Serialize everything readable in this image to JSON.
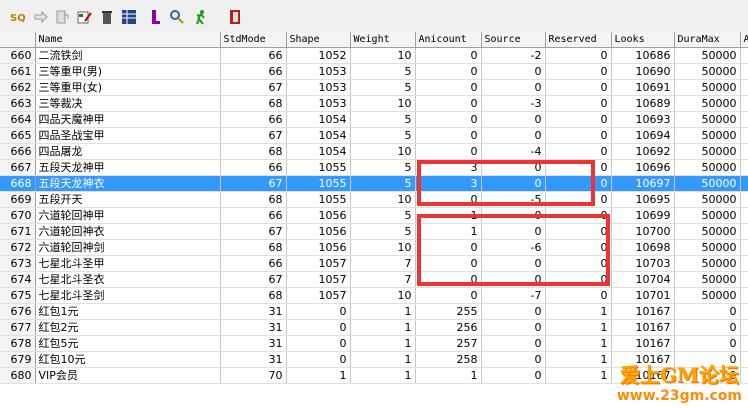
{
  "columns": [
    "",
    "Name",
    "StdMode",
    "Shape",
    "Weight",
    "Anicount",
    "Source",
    "Reserved",
    "Looks",
    "DuraMax",
    "A"
  ],
  "rows": [
    [
      "660",
      "二流铁剑",
      "66",
      "1052",
      "10",
      "0",
      "-2",
      "0",
      "10686",
      "50000"
    ],
    [
      "661",
      "三等重甲(男)",
      "66",
      "1053",
      "5",
      "0",
      "0",
      "0",
      "10690",
      "50000"
    ],
    [
      "662",
      "三等重甲(女)",
      "67",
      "1053",
      "5",
      "0",
      "0",
      "0",
      "10691",
      "50000"
    ],
    [
      "663",
      "三等裁决",
      "68",
      "1053",
      "10",
      "0",
      "-3",
      "0",
      "10689",
      "50000"
    ],
    [
      "664",
      "四品天魔神甲",
      "66",
      "1054",
      "5",
      "0",
      "0",
      "0",
      "10693",
      "50000"
    ],
    [
      "665",
      "四品圣战宝甲",
      "67",
      "1054",
      "5",
      "0",
      "0",
      "0",
      "10694",
      "50000"
    ],
    [
      "666",
      "四品屠龙",
      "68",
      "1054",
      "10",
      "0",
      "-4",
      "0",
      "10692",
      "50000"
    ],
    [
      "667",
      "五段天龙神甲",
      "66",
      "1055",
      "5",
      "3",
      "0",
      "0",
      "10696",
      "50000"
    ],
    [
      "668",
      "五段天龙神衣",
      "67",
      "1055",
      "5",
      "3",
      "0",
      "0",
      "10697",
      "50000"
    ],
    [
      "669",
      "五段开天",
      "68",
      "1055",
      "10",
      "0",
      "-5",
      "0",
      "10695",
      "50000"
    ],
    [
      "670",
      "六道轮回神甲",
      "66",
      "1056",
      "5",
      "1",
      "0",
      "0",
      "10699",
      "50000"
    ],
    [
      "671",
      "六道轮回神衣",
      "67",
      "1056",
      "5",
      "1",
      "0",
      "0",
      "10700",
      "50000"
    ],
    [
      "672",
      "六道轮回神剑",
      "68",
      "1056",
      "10",
      "0",
      "-6",
      "0",
      "10698",
      "50000"
    ],
    [
      "673",
      "七星北斗圣甲",
      "66",
      "1057",
      "7",
      "0",
      "0",
      "0",
      "10703",
      "50000"
    ],
    [
      "674",
      "七星北斗圣衣",
      "67",
      "1057",
      "7",
      "0",
      "0",
      "0",
      "10704",
      "50000"
    ],
    [
      "675",
      "七星北斗圣剑",
      "68",
      "1057",
      "10",
      "0",
      "-7",
      "0",
      "10701",
      "50000"
    ],
    [
      "676",
      "红包1元",
      "31",
      "0",
      "1",
      "255",
      "0",
      "1",
      "10167",
      "0"
    ],
    [
      "677",
      "红包2元",
      "31",
      "0",
      "1",
      "256",
      "0",
      "1",
      "10167",
      "0"
    ],
    [
      "678",
      "红包5元",
      "31",
      "0",
      "1",
      "257",
      "0",
      "1",
      "10167",
      "0"
    ],
    [
      "679",
      "红包10元",
      "31",
      "0",
      "1",
      "258",
      "0",
      "1",
      "10167",
      "0"
    ],
    [
      "680",
      "VIP会员",
      "70",
      "1",
      "1",
      "1",
      "0",
      "1",
      "10167",
      "0"
    ]
  ],
  "selected_row": "668",
  "watermark": {
    "line1": "爱上GM论坛",
    "line2": "www.23gm.com"
  },
  "colors": {
    "selection": "#3399ff",
    "highlight_box": "#ee3333"
  }
}
